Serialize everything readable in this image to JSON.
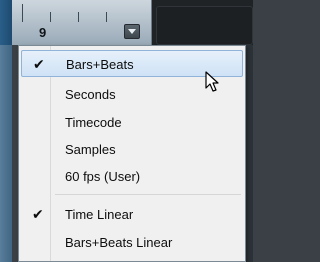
{
  "ruler": {
    "number": "9"
  },
  "menu": {
    "items": [
      {
        "label": "Bars+Beats",
        "checked": true,
        "highlighted": true
      },
      {
        "label": "Seconds",
        "checked": false
      },
      {
        "label": "Timecode",
        "checked": false
      },
      {
        "label": "Samples",
        "checked": false
      },
      {
        "label": "60 fps (User)",
        "checked": false
      },
      {
        "label": "Time Linear",
        "checked": true
      },
      {
        "label": "Bars+Beats Linear",
        "checked": false
      }
    ],
    "check_glyph": "✔"
  },
  "colors": {
    "highlight_fill": "#cfe2f6",
    "highlight_border": "#8fb3d9",
    "menu_bg": "#f0f0f0"
  },
  "icons": {
    "cursor": "mouse-pointer-icon",
    "dropdown": "chevron-down-icon",
    "check": "checkmark-icon"
  }
}
